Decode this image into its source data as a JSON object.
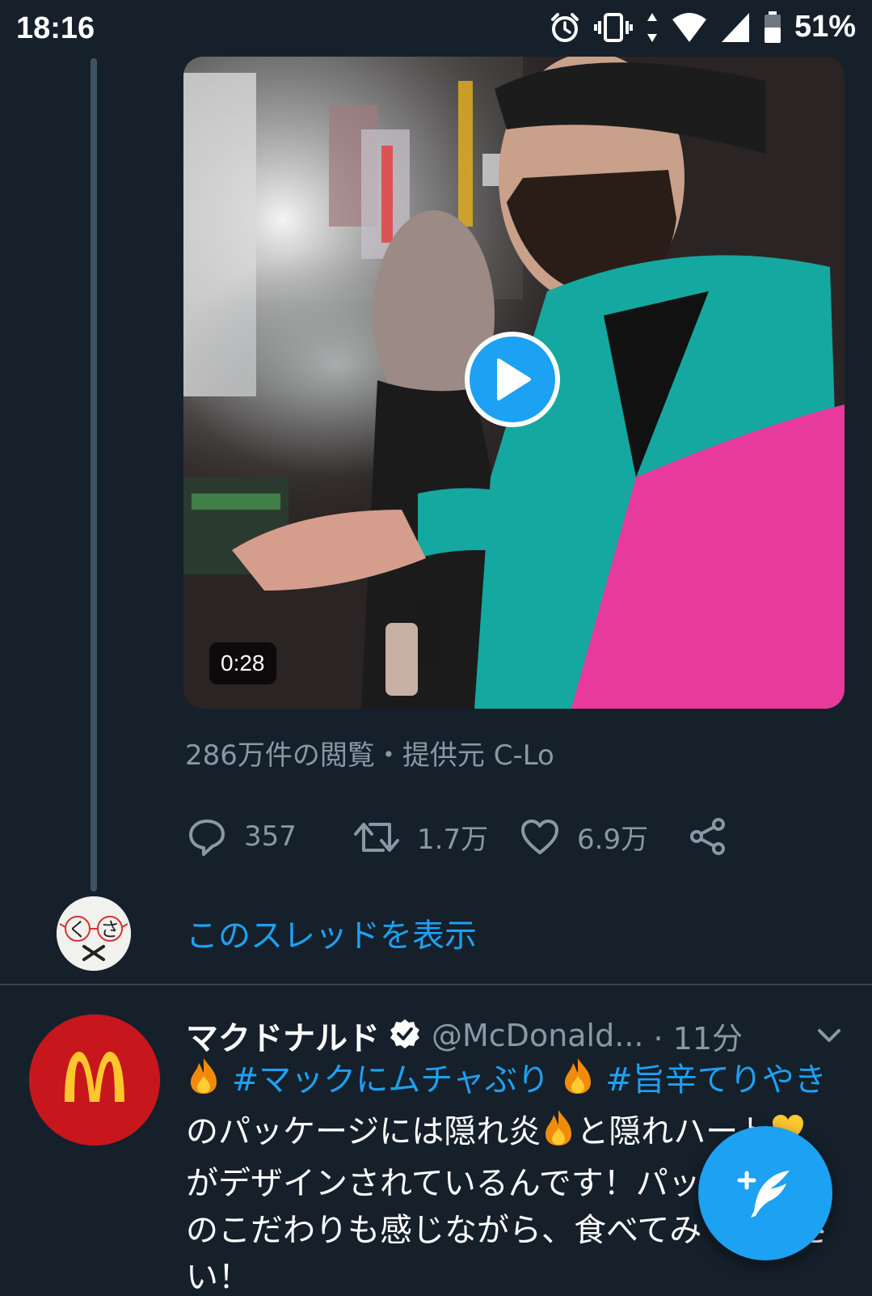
{
  "status_bar": {
    "time": "18:16",
    "battery": "51%",
    "icons": [
      "alarm-icon",
      "vibrate-icon",
      "data-arrows-icon",
      "wifi-icon",
      "signal-icon",
      "battery-icon"
    ]
  },
  "video_tweet": {
    "duration": "0:28",
    "views": "286万件の閲覧・提供元 C-Lo",
    "actions": {
      "replies": "357",
      "retweets": "1.7万",
      "likes": "6.9万"
    }
  },
  "thread": {
    "show_thread_label": "このスレッドを表示",
    "avatar_text_left": "く",
    "avatar_text_right": "さ"
  },
  "tweet": {
    "author_name": "マクドナルド",
    "handle": "@McDonald...",
    "timestamp": "· 11分",
    "body_hashtag1": "#マックにムチャぶり",
    "body_hashtag2": "#旨辛てりやき",
    "body_text1": " のパッケージには隠れ炎",
    "body_text2": "と隠れハート",
    "body_text3": "がデザインされているんです！パッケージへのこだわりも感じながら、食べてみてください！"
  },
  "colors": {
    "background": "#15202b",
    "accent": "#1da1f2",
    "muted": "#8899a6",
    "mcd_red": "#c8161d",
    "mcd_yellow": "#ffc72c"
  }
}
